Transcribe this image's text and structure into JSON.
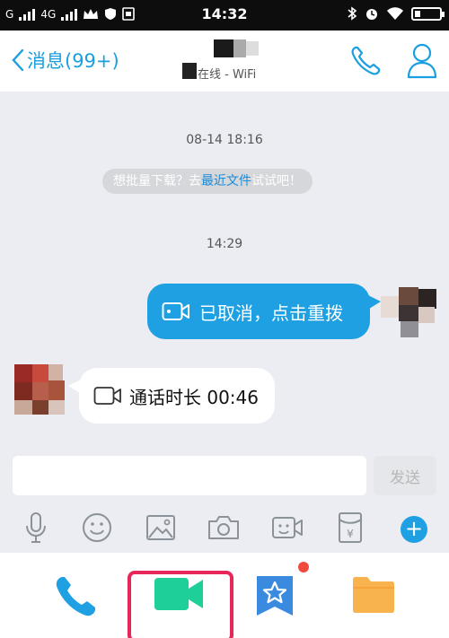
{
  "status_bar": {
    "carrier_label": "G",
    "network_label": "4G",
    "time": "14:32"
  },
  "header": {
    "back_label": "消息(99+)",
    "contact_status": "在线 - WiFi"
  },
  "chat": {
    "timestamp_1": "08-14 18:16",
    "tip_prefix": "想批量下载？去",
    "tip_link": "最近文件",
    "tip_suffix": "试试吧！",
    "timestamp_2": "14:29",
    "sent_message": "已取消，点击重拨",
    "received_message": "通话时长 00:46"
  },
  "input": {
    "placeholder": "",
    "send_label": "发送"
  },
  "toolbar": {
    "icons": [
      "microphone-icon",
      "emoji-icon",
      "image-icon",
      "camera-icon",
      "video-icon",
      "red-packet-icon",
      "plus-icon"
    ],
    "plus_label": "+"
  },
  "panel": {
    "items": [
      {
        "label": "",
        "icon": "phone-icon"
      },
      {
        "label": "",
        "icon": "video-call-icon"
      },
      {
        "label": "",
        "icon": "favorites-icon"
      },
      {
        "label": "",
        "icon": "folder-icon"
      }
    ],
    "red_packet_symbol": "¥"
  },
  "colors": {
    "accent_blue": "#1ea0e3",
    "chat_background": "#ebedf2",
    "highlight_frame": "#e8265a",
    "video_green": "#1fcf9a",
    "folder_orange": "#f8b34f"
  }
}
